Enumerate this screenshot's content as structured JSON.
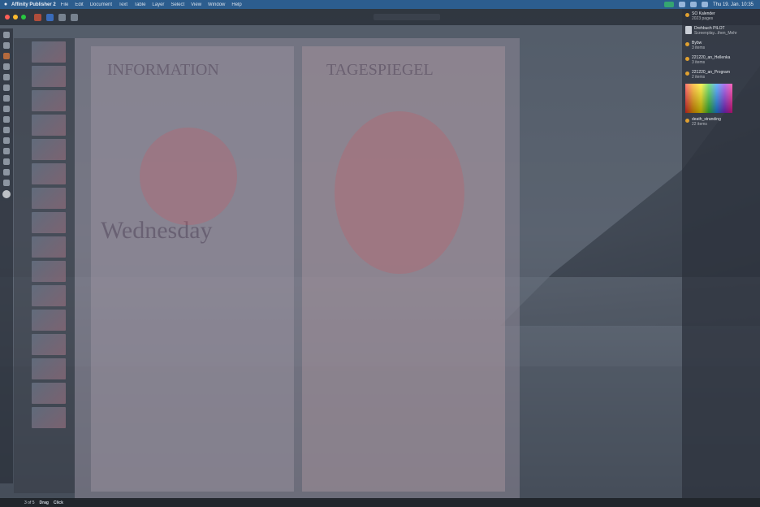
{
  "menubar": {
    "app_name": "Affinity Publisher 2",
    "items": [
      "File",
      "Edit",
      "Document",
      "Text",
      "Table",
      "Layer",
      "Select",
      "View",
      "Window",
      "Help"
    ],
    "clock": "Thu 19. Jan. 10:35"
  },
  "right_panel": {
    "items": [
      {
        "title": "SO Kalender",
        "sub": "2023 pages"
      },
      {
        "title": "Drehbuch PILOT",
        "sub": "Screenplay...then_Mehr"
      },
      {
        "title": "Bybw",
        "sub": "3 items"
      },
      {
        "title": "221220_an_Hellenka",
        "sub": "3 items"
      },
      {
        "title": "221220_an_Program",
        "sub": "2 items"
      },
      {
        "title": "death_stranding",
        "sub": "22 items"
      }
    ]
  },
  "canvas": {
    "heading_left": "INFORMATION",
    "heading_right": "TAGESPIEGEL",
    "big_word": "Wednesday"
  },
  "statusbar": {
    "page": "3 of 5",
    "hint_label": "Drag",
    "hint_action": "Click"
  },
  "colors": {
    "menubar": "#2c5d8e",
    "accent": "#d0523a"
  }
}
